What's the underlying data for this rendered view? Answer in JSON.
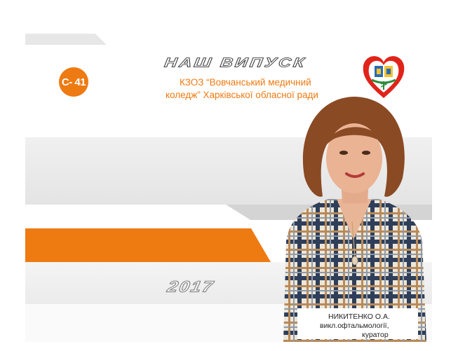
{
  "group_code": "С- 41",
  "headline": "НАШ ВИПУСК",
  "college": {
    "line1": "КЗОЗ “Вовчанський медичний",
    "line2": "коледж” Харківської обласної ради"
  },
  "year": "2017",
  "curator": {
    "name": "НИКИТЕНКО О.А.",
    "role": "викл.офтальмології,",
    "title": "куратор"
  },
  "colors": {
    "accent": "#ee7a12",
    "band_gray": "#e4e4e4",
    "logo_red": "#e2231a",
    "logo_green": "#2e8b3a"
  },
  "icons": [
    "college-heart-logo"
  ]
}
